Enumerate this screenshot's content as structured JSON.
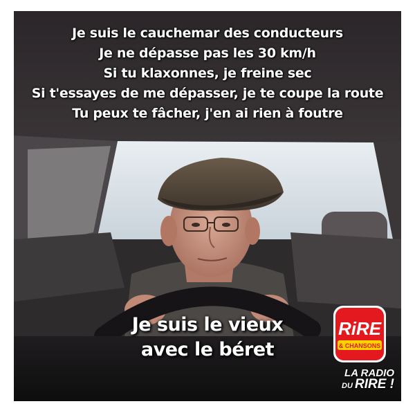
{
  "meme": {
    "top_lines": [
      "Je suis le cauchemar des conducteurs",
      "Je ne dépasse pas les 30 km/h",
      "Si tu klaxonnes, je freine sec",
      "Si t'essayes de me dépasser, je te coupe la route",
      "Tu peux te fâcher, j'en ai rien à foutre"
    ],
    "bottom_lines": [
      "Je suis le vieux",
      "avec le béret"
    ]
  },
  "branding": {
    "logo_top": "RIRE",
    "logo_bottom": "& CHANSONS",
    "tagline_line1": "LA RADIO",
    "tagline_line2_prefix": "DU",
    "tagline_line2_main": "RIRE !",
    "logo_color": "#e3191f"
  }
}
